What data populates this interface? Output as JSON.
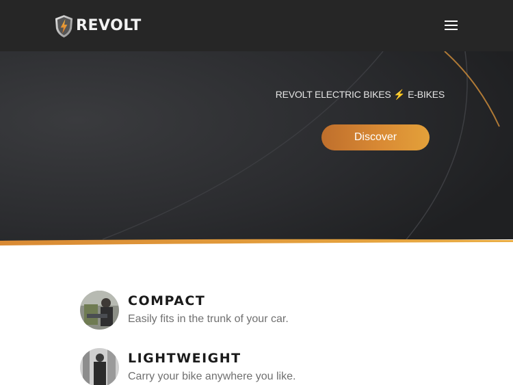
{
  "colors": {
    "header_bg": "#262626",
    "accent": "#d98a34",
    "text_dark": "#1a1a1a",
    "text_muted": "#6f6f6f"
  },
  "header": {
    "logo_text": "REVOLT",
    "logo_icon": "bolt-shield-icon",
    "menu_icon": "hamburger-menu-icon"
  },
  "hero": {
    "tagline": "REVOLT ELECTRIC BIKES ⚡ E-BIKES",
    "cta_label": "Discover"
  },
  "features": [
    {
      "title": "COMPACT",
      "description": "Easily fits in the trunk of your car."
    },
    {
      "title": "LIGHTWEIGHT",
      "description": "Carry your bike anywhere you like."
    }
  ]
}
